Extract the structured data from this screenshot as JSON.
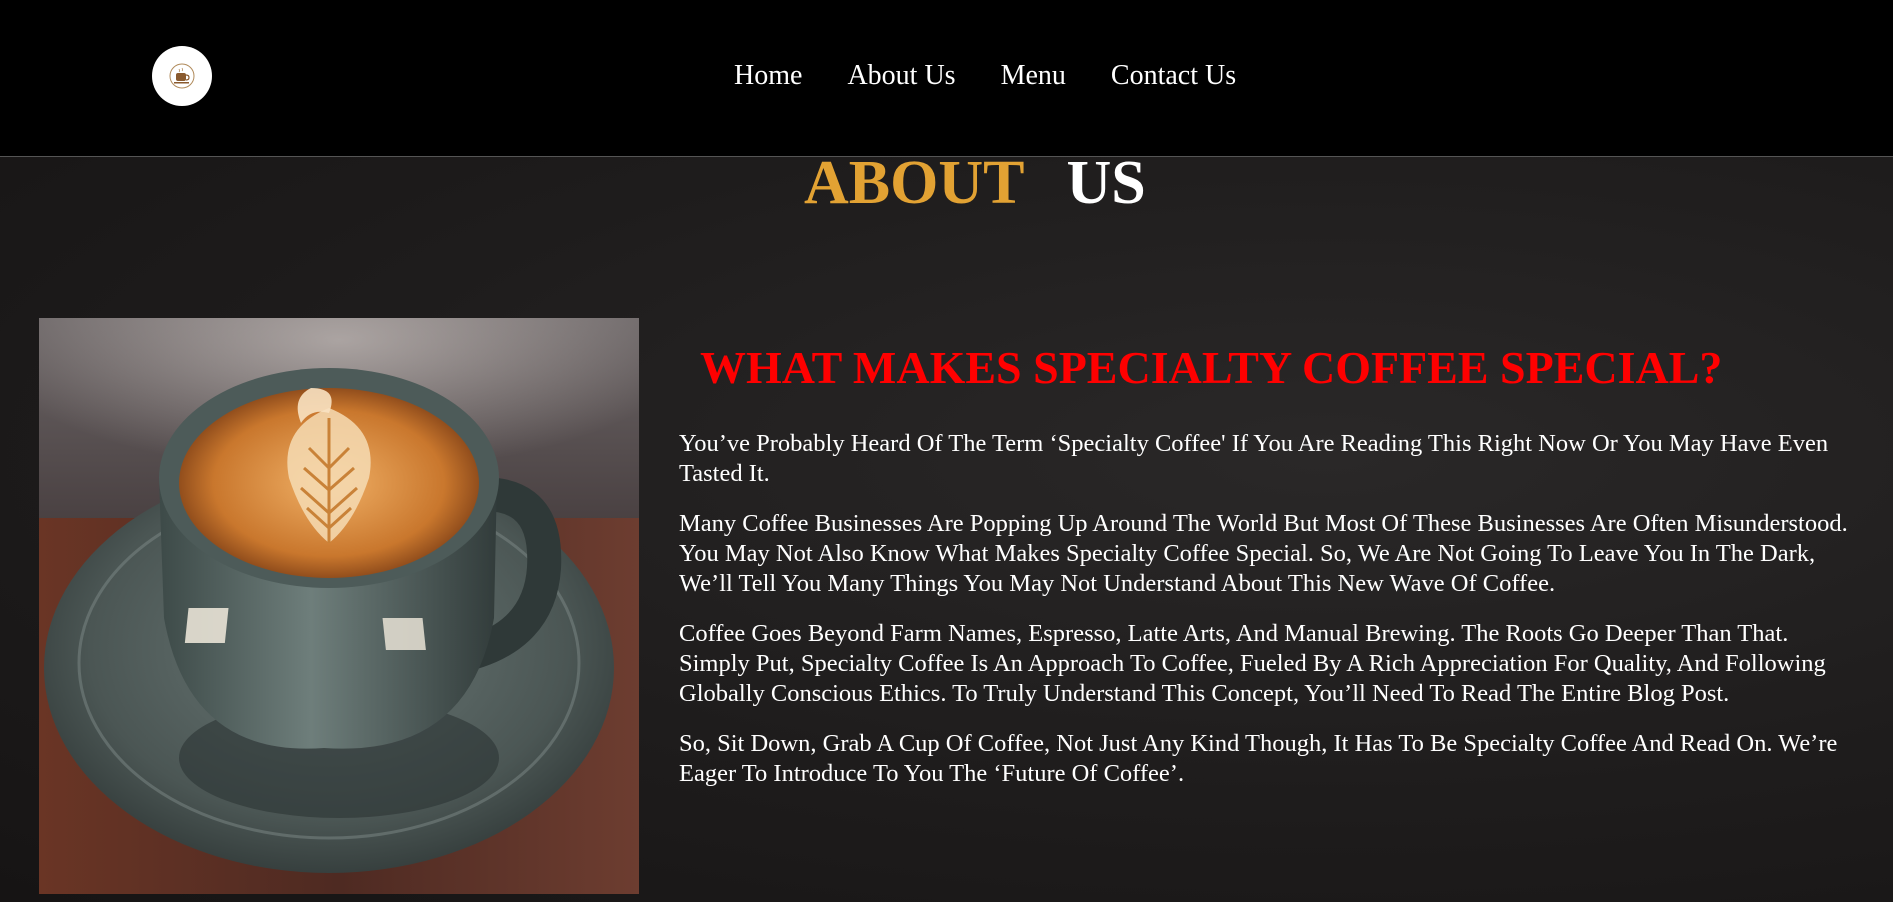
{
  "nav": {
    "logo_icon": "coffee-cup-icon",
    "links": [
      {
        "label": "Home"
      },
      {
        "label": "About Us"
      },
      {
        "label": "Menu"
      },
      {
        "label": "Contact Us"
      }
    ]
  },
  "about": {
    "title_part1": "ABOUT",
    "title_part2": "US",
    "subheading": "WHAT MAKES SPECIALTY COFFEE SPECIAL?",
    "image": "latte-art-coffee-cup",
    "paragraphs": [
      "You’ve Probably Heard Of The Term ‘Specialty Coffee' If You Are Reading This Right Now Or You May Have Even Tasted It.",
      "Many Coffee Businesses Are Popping Up Around The World But Most Of These Businesses Are Often Misunderstood. You May Not Also Know What Makes Specialty Coffee Special. So, We Are Not Going To Leave You In The Dark, We’ll Tell You Many Things You May Not Understand About This New Wave Of Coffee.",
      "Coffee Goes Beyond Farm Names, Espresso, Latte Arts, And Manual Brewing. The Roots Go Deeper Than That. Simply Put, Specialty Coffee Is An Approach To Coffee, Fueled By A Rich Appreciation For Quality, And Following Globally Conscious Ethics. To Truly Understand This Concept, You’ll Need To Read The Entire Blog Post.",
      "So, Sit Down, Grab A Cup Of Coffee, Not Just Any Kind Though, It Has To Be Specialty Coffee And Read On. We’re Eager To Introduce To You The ‘Future Of Coffee’."
    ]
  },
  "colors": {
    "nav_bg": "#000000",
    "accent_gold": "#e2a233",
    "accent_red": "#ff0000",
    "text": "#ffffff"
  }
}
